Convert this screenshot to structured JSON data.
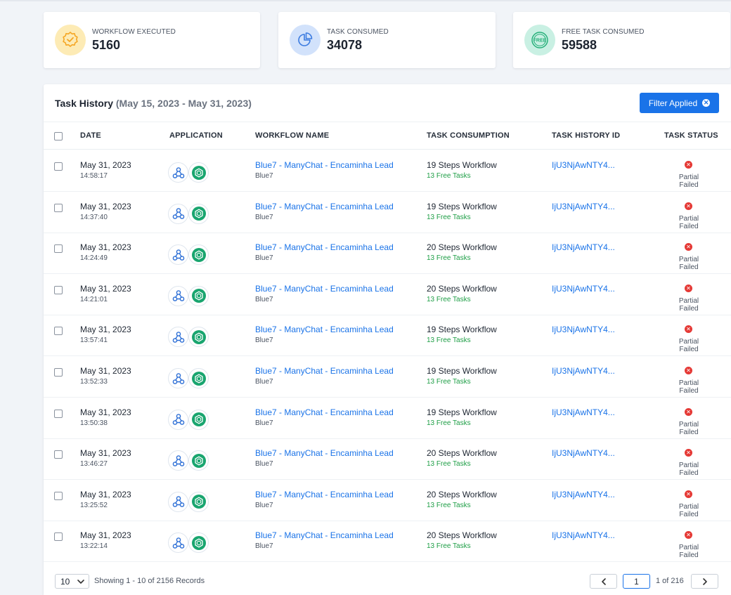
{
  "stats": [
    {
      "label": "WORKFLOW EXECUTED",
      "value": "5160",
      "icon": "verified-badge-icon",
      "color": "#f5a623"
    },
    {
      "label": "TASK CONSUMED",
      "value": "34078",
      "icon": "pie-chart-icon",
      "color": "#3b7be0"
    },
    {
      "label": "FREE TASK CONSUMED",
      "value": "59588",
      "icon": "free-badge-icon",
      "color": "#27b07a"
    }
  ],
  "panel": {
    "title": "Task History",
    "range": "(May 15, 2023 - May 31, 2023)",
    "filter_label": "Filter Applied"
  },
  "columns": {
    "date": "DATE",
    "application": "APPLICATION",
    "workflow_name": "WORKFLOW NAME",
    "task_consumption": "TASK CONSUMPTION",
    "task_history_id": "TASK HISTORY ID",
    "task_status": "TASK STATUS"
  },
  "rows": [
    {
      "date": "May 31, 2023",
      "time": "14:58:17",
      "workflow": "Blue7 - ManyChat - Encaminha Lead",
      "sub": "Blue7",
      "steps": "19 Steps Workflow",
      "free": "13 Free Tasks",
      "id": "IjU3NjAwNTY4...",
      "status": "Partial Failed"
    },
    {
      "date": "May 31, 2023",
      "time": "14:37:40",
      "workflow": "Blue7 - ManyChat - Encaminha Lead",
      "sub": "Blue7",
      "steps": "19 Steps Workflow",
      "free": "13 Free Tasks",
      "id": "IjU3NjAwNTY4...",
      "status": "Partial Failed"
    },
    {
      "date": "May 31, 2023",
      "time": "14:24:49",
      "workflow": "Blue7 - ManyChat - Encaminha Lead",
      "sub": "Blue7",
      "steps": "20 Steps Workflow",
      "free": "13 Free Tasks",
      "id": "IjU3NjAwNTY4...",
      "status": "Partial Failed"
    },
    {
      "date": "May 31, 2023",
      "time": "14:21:01",
      "workflow": "Blue7 - ManyChat - Encaminha Lead",
      "sub": "Blue7",
      "steps": "20 Steps Workflow",
      "free": "13 Free Tasks",
      "id": "IjU3NjAwNTY4...",
      "status": "Partial Failed"
    },
    {
      "date": "May 31, 2023",
      "time": "13:57:41",
      "workflow": "Blue7 - ManyChat - Encaminha Lead",
      "sub": "Blue7",
      "steps": "19 Steps Workflow",
      "free": "13 Free Tasks",
      "id": "IjU3NjAwNTY4...",
      "status": "Partial Failed"
    },
    {
      "date": "May 31, 2023",
      "time": "13:52:33",
      "workflow": "Blue7 - ManyChat - Encaminha Lead",
      "sub": "Blue7",
      "steps": "19 Steps Workflow",
      "free": "13 Free Tasks",
      "id": "IjU3NjAwNTY4...",
      "status": "Partial Failed"
    },
    {
      "date": "May 31, 2023",
      "time": "13:50:38",
      "workflow": "Blue7 - ManyChat - Encaminha Lead",
      "sub": "Blue7",
      "steps": "19 Steps Workflow",
      "free": "13 Free Tasks",
      "id": "IjU3NjAwNTY4...",
      "status": "Partial Failed"
    },
    {
      "date": "May 31, 2023",
      "time": "13:46:27",
      "workflow": "Blue7 - ManyChat - Encaminha Lead",
      "sub": "Blue7",
      "steps": "20 Steps Workflow",
      "free": "13 Free Tasks",
      "id": "IjU3NjAwNTY4...",
      "status": "Partial Failed"
    },
    {
      "date": "May 31, 2023",
      "time": "13:25:52",
      "workflow": "Blue7 - ManyChat - Encaminha Lead",
      "sub": "Blue7",
      "steps": "20 Steps Workflow",
      "free": "13 Free Tasks",
      "id": "IjU3NjAwNTY4...",
      "status": "Partial Failed"
    },
    {
      "date": "May 31, 2023",
      "time": "13:22:14",
      "workflow": "Blue7 - ManyChat - Encaminha Lead",
      "sub": "Blue7",
      "steps": "20 Steps Workflow",
      "free": "13 Free Tasks",
      "id": "IjU3NjAwNTY4...",
      "status": "Partial Failed"
    }
  ],
  "footer": {
    "page_size": "10",
    "showing": "Showing 1 - 10 of 2156 Records",
    "current_page": "1",
    "of_pages": "1 of 216"
  },
  "colors": {
    "accent": "#1a73e8",
    "free_tasks": "#1e9e46",
    "failed": "#e53935"
  },
  "app_icons": [
    "webhook-icon",
    "chatgpt-icon"
  ]
}
